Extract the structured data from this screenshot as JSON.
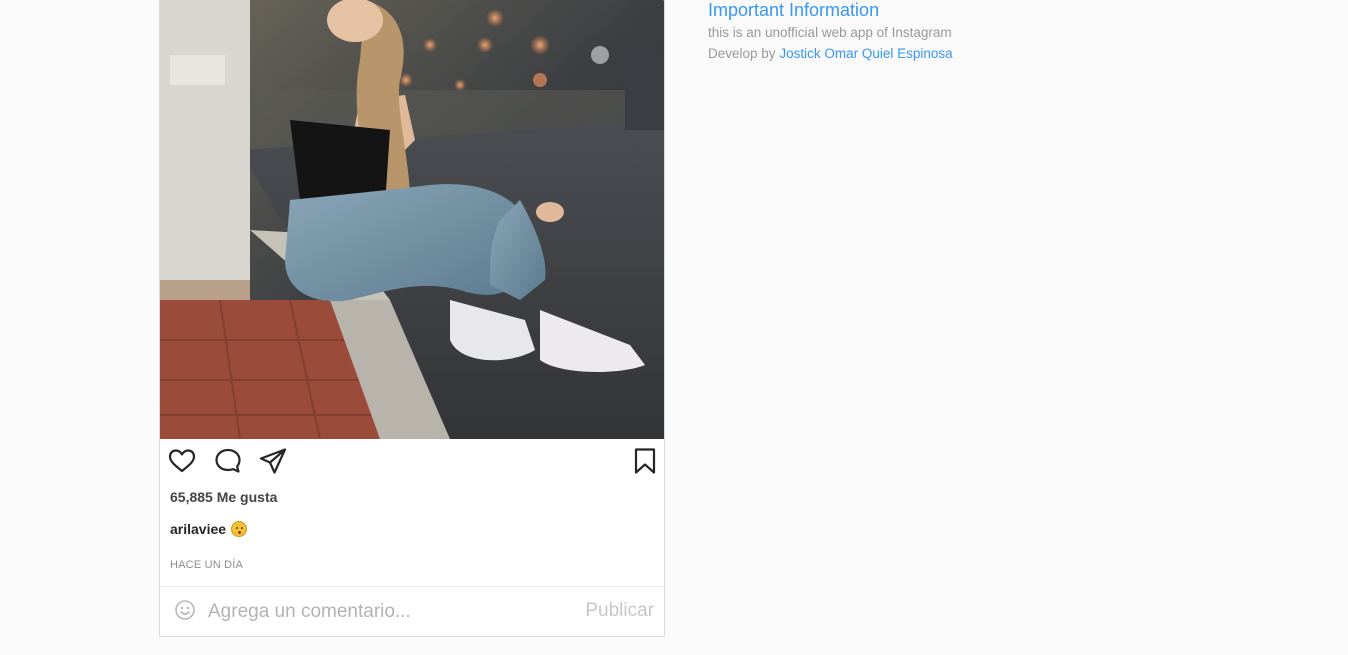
{
  "post": {
    "image_alt": "photo",
    "likes_text": "65,885 Me gusta",
    "caption_user": "arilaviee",
    "caption_emoji": "kissing-face-emoji",
    "timestamp": "HACE UN DÍA",
    "comment_placeholder": "Agrega un comentario...",
    "publish_label": "Publicar",
    "icons": {
      "like": "heart-icon",
      "comment": "comment-icon",
      "share": "paper-plane-icon",
      "save": "bookmark-icon",
      "emoji": "smiley-icon"
    }
  },
  "info": {
    "title": "Important Information",
    "disclaimer": "this is an unofficial web app of Instagram",
    "developed_prefix": "Develop by",
    "developer_name": "Jostick Omar Quiel Espinosa"
  },
  "colors": {
    "link": "#3897f0",
    "background": "#fafafa",
    "muted": "#8e8e8e"
  }
}
